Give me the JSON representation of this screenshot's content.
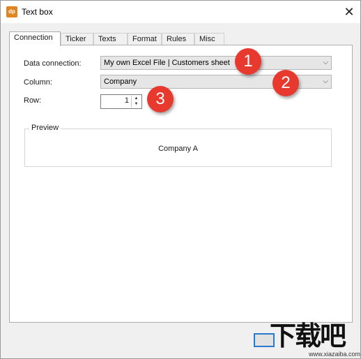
{
  "window": {
    "title": "Text box",
    "app_icon_text": "dp",
    "close_glyph": "✕"
  },
  "tabs": [
    {
      "label": "Connection",
      "active": true
    },
    {
      "label": "Ticker",
      "active": false
    },
    {
      "label": "Texts",
      "active": false
    },
    {
      "label": "Format",
      "active": false
    },
    {
      "label": "Rules",
      "active": false
    },
    {
      "label": "Misc",
      "active": false
    }
  ],
  "form": {
    "data_connection_label": "Data connection:",
    "data_connection_value": "My own Excel File | Customers sheet",
    "column_label": "Column:",
    "column_value": "Company",
    "row_label": "Row:",
    "row_value": "1"
  },
  "preview": {
    "legend": "Preview",
    "text": "Company A"
  },
  "annotations": [
    {
      "number": "1"
    },
    {
      "number": "2"
    },
    {
      "number": "3"
    }
  ],
  "watermark": {
    "chars": "下载吧",
    "url": "www.xiazaiba.com"
  },
  "colors": {
    "badge": "#e8392e",
    "accent": "#2b78d0",
    "app_icon": "#e0841e"
  },
  "icons": {
    "dropdown": "chevron-down-icon",
    "close": "close-icon",
    "spin_up": "spin-up-icon",
    "spin_down": "spin-down-icon"
  }
}
